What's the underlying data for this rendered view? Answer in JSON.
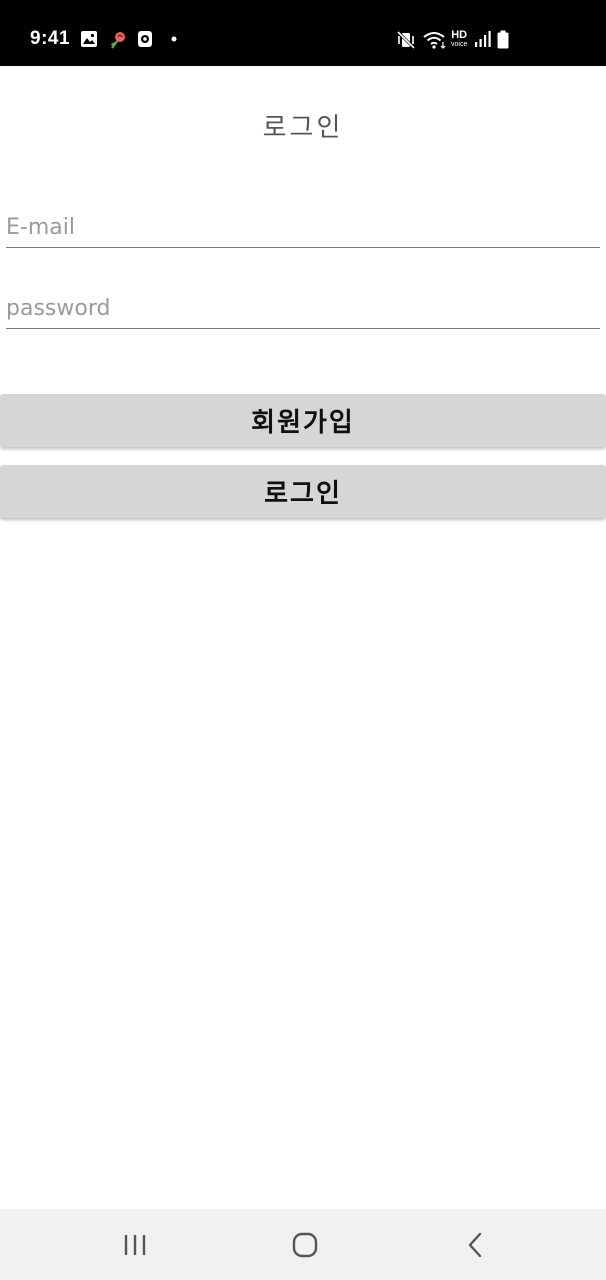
{
  "status_bar": {
    "time": "9:41",
    "hd_label": "HD",
    "hd_sub": "voice",
    "icons": [
      "gallery-icon",
      "rose-icon",
      "cast-icon",
      "dot-icon",
      "mute-vibrate-icon",
      "wifi-icon",
      "hd-voice-icon",
      "signal-icon",
      "battery-icon"
    ]
  },
  "header": {
    "title": "로그인"
  },
  "form": {
    "email_placeholder": "E-mail",
    "email_value": "",
    "password_placeholder": "password",
    "password_value": ""
  },
  "buttons": {
    "signup_label": "회원가입",
    "login_label": "로그인"
  },
  "nav_bar": {
    "icons": [
      "recent-apps-icon",
      "home-icon",
      "back-icon"
    ]
  },
  "colors": {
    "status_bar_bg": "#000000",
    "button_bg": "#d6d6d6",
    "nav_bar_bg": "#f1f1f1",
    "underline": "#7a7a7a"
  }
}
